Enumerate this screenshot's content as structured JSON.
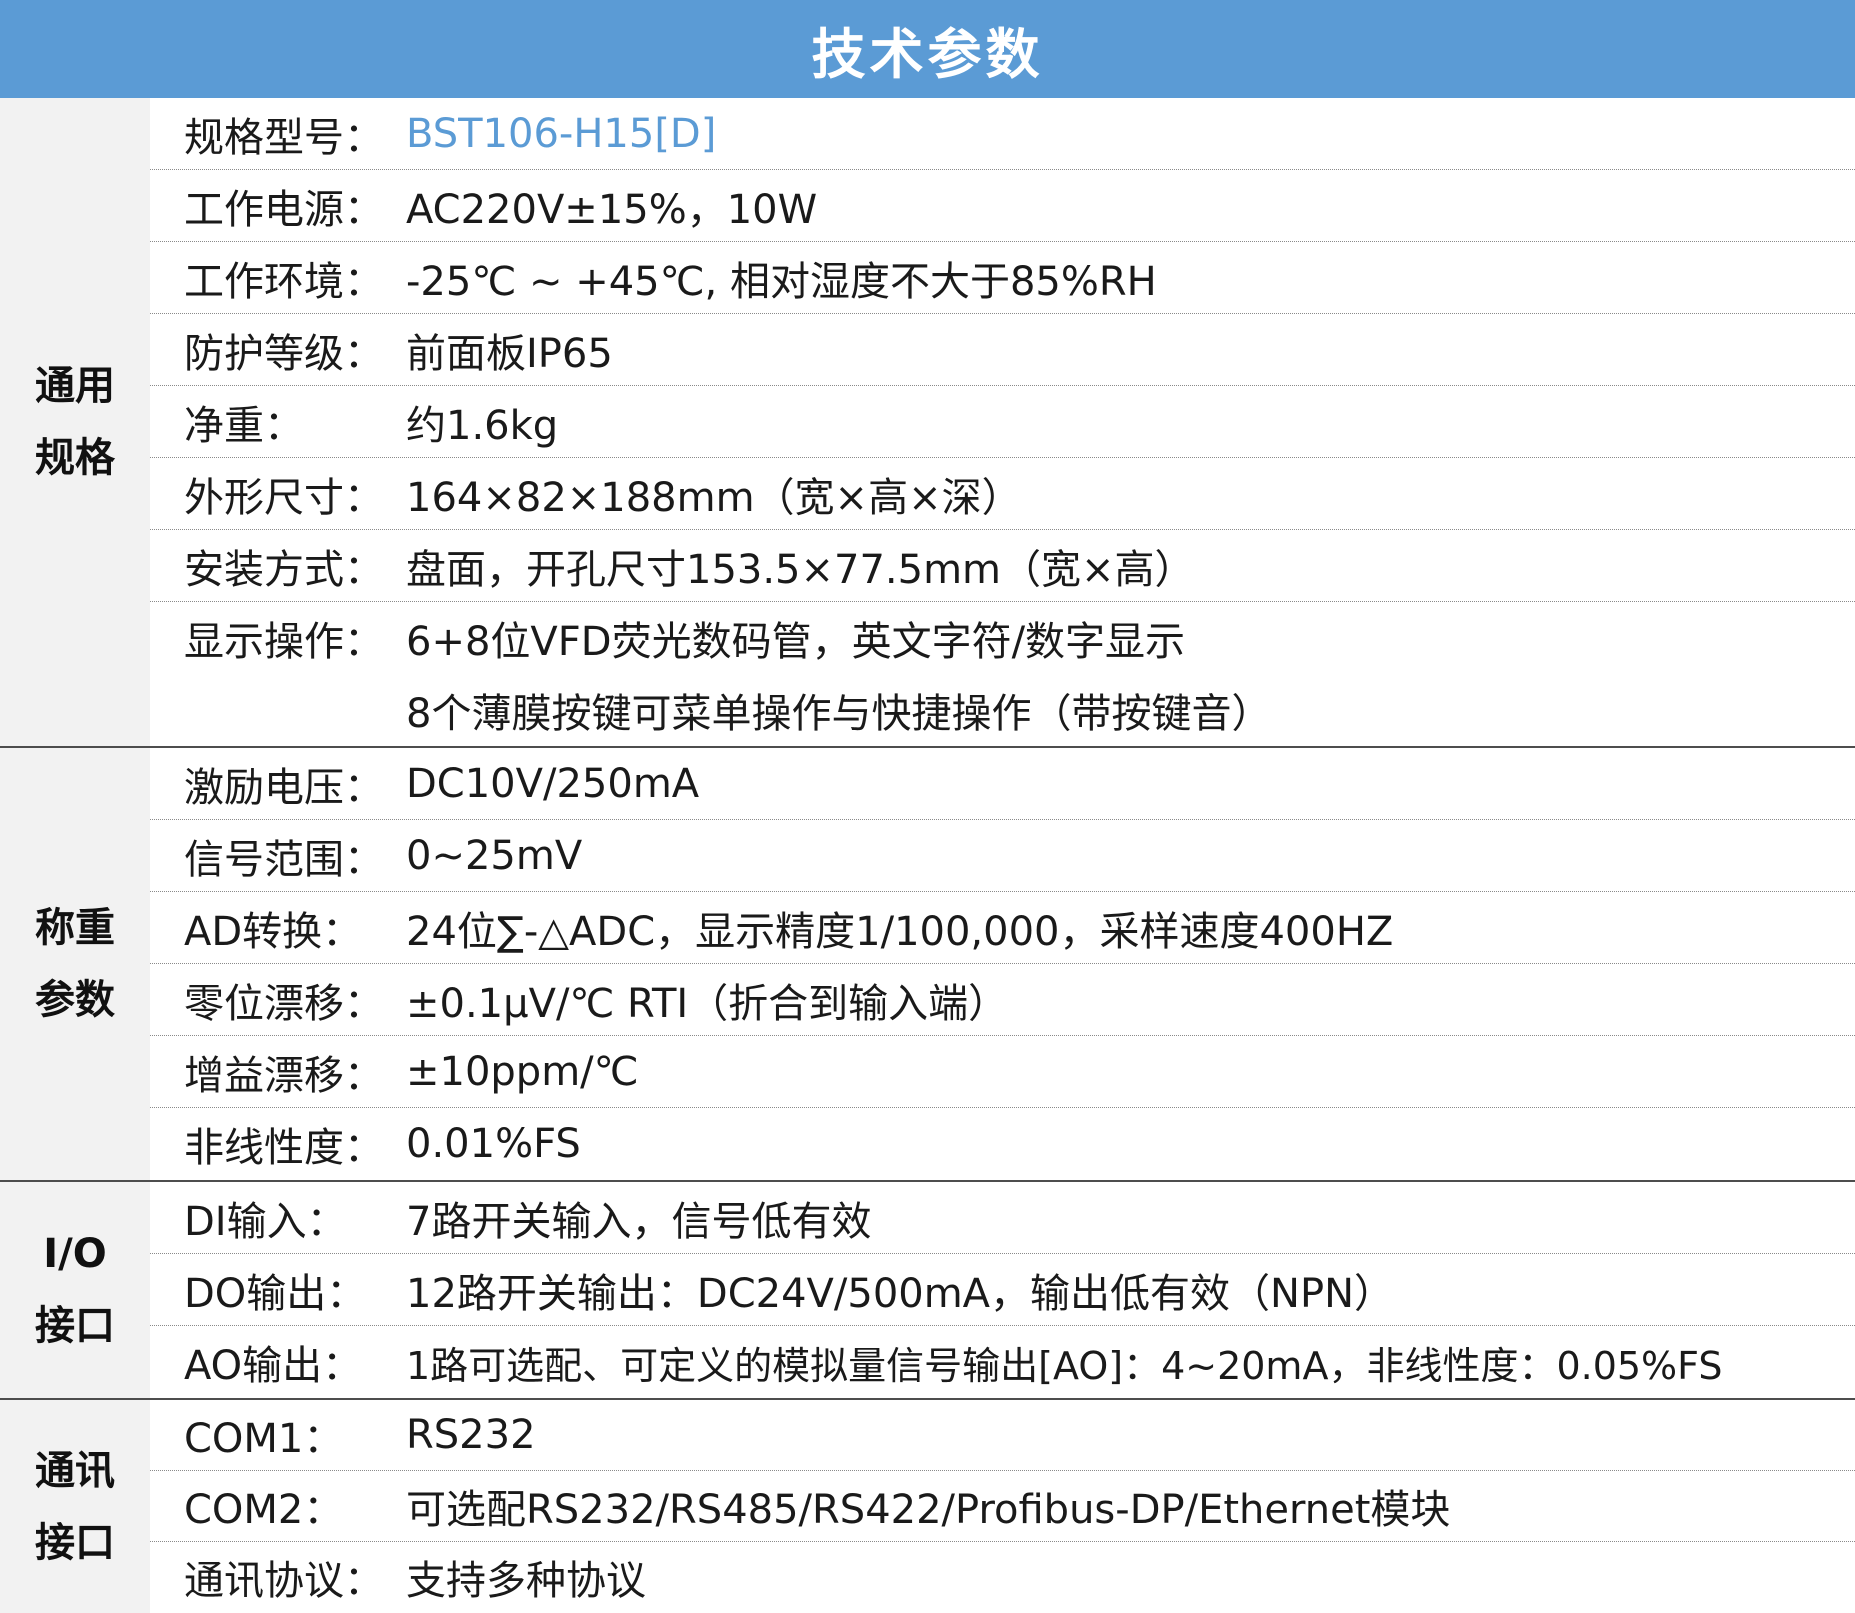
{
  "header": {
    "title": "技术参数"
  },
  "colors": {
    "header_bg": "#5b9bd5",
    "label_bg": "#f2f2f2",
    "accent_text": "#5b9bd5"
  },
  "sections": [
    {
      "label_line1": "通用",
      "label_line2": "规格",
      "rows": [
        {
          "key": "规格型号：",
          "value": "BST106-H15[D]"
        },
        {
          "key": "工作电源：",
          "value": "AC220V±15%，10W"
        },
        {
          "key": "工作环境：",
          "value": "-25℃ ~ +45℃, 相对湿度不大于85%RH"
        },
        {
          "key": "防护等级：",
          "value": "前面板IP65"
        },
        {
          "key": "净重：",
          "value": "约1.6kg"
        },
        {
          "key": "外形尺寸：",
          "value": "164×82×188mm（宽×高×深）"
        },
        {
          "key": "安装方式：",
          "value": "盘面，开孔尺寸153.5×77.5mm（宽×高）"
        },
        {
          "key": "显示操作：",
          "value": " 6+8位VFD荧光数码管，英文字符/数字显示"
        },
        {
          "key": "",
          "value": "8个薄膜按键可菜单操作与快捷操作（带按键音）"
        }
      ]
    },
    {
      "label_line1": "称重",
      "label_line2": "参数",
      "rows": [
        {
          "key": "激励电压：",
          "value": "DC10V/250mA"
        },
        {
          "key": "信号范围：",
          "value": "0~25mV"
        },
        {
          "key": "AD转换：",
          "value": "24位∑-△ADC，显示精度1/100,000，采样速度400HZ"
        },
        {
          "key": "零位漂移：",
          "value": "±0.1μV/℃ RTI（折合到输入端）"
        },
        {
          "key": "增益漂移：",
          "value": "±10ppm/℃"
        },
        {
          "key": "非线性度：",
          "value": "0.01%FS"
        }
      ]
    },
    {
      "label_line1": "I/O",
      "label_line2": "接口",
      "rows": [
        {
          "key": "DI输入：",
          "value": "7路开关输入，信号低有效"
        },
        {
          "key": "DO输出：",
          "value": "12路开关输出：DC24V/500mA，输出低有效（NPN）"
        },
        {
          "key": "AO输出：",
          "value": "1路可选配、可定义的模拟量信号输出[AO]：4~20mA，非线性度：0.05%FS"
        }
      ]
    },
    {
      "label_line1": "通讯",
      "label_line2": "接口",
      "rows": [
        {
          "key": "COM1：",
          "value": "RS232"
        },
        {
          "key": "COM2：",
          "value": "可选配RS232/RS485/RS422/Profibus-DP/Ethernet模块"
        },
        {
          "key": "通讯协议：",
          "value": "支持多种协议"
        }
      ]
    }
  ]
}
